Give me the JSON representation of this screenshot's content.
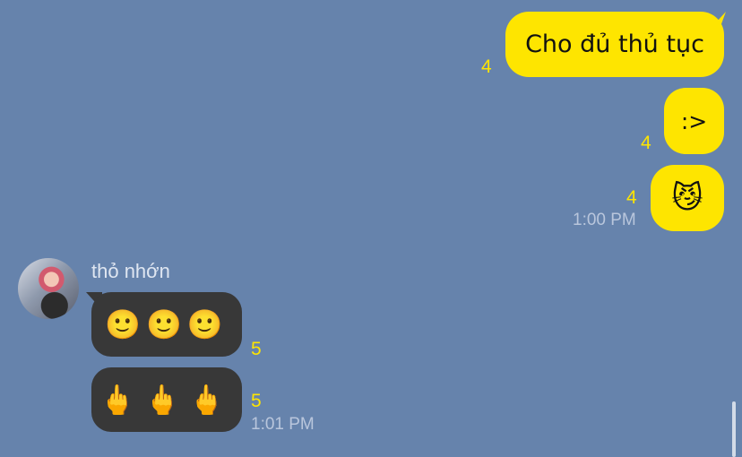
{
  "messages": {
    "outgoing": [
      {
        "text": "Cho đủ thủ tục",
        "unread": "4"
      },
      {
        "text": ":>",
        "unread": "4"
      },
      {
        "text": "😼",
        "unread": "4"
      }
    ],
    "outgoing_time": "1:00 PM",
    "incoming_sender": "thỏ nhớn",
    "incoming": [
      {
        "text": "🙂🙂🙂",
        "unread": "5"
      },
      {
        "text": "🖕🖕🖕",
        "unread": "5"
      }
    ],
    "incoming_time": "1:01 PM"
  },
  "colors": {
    "background": "#6683ac",
    "outgoing_bubble": "#fee500",
    "incoming_bubble": "#383838",
    "unread_count": "#fee500"
  }
}
